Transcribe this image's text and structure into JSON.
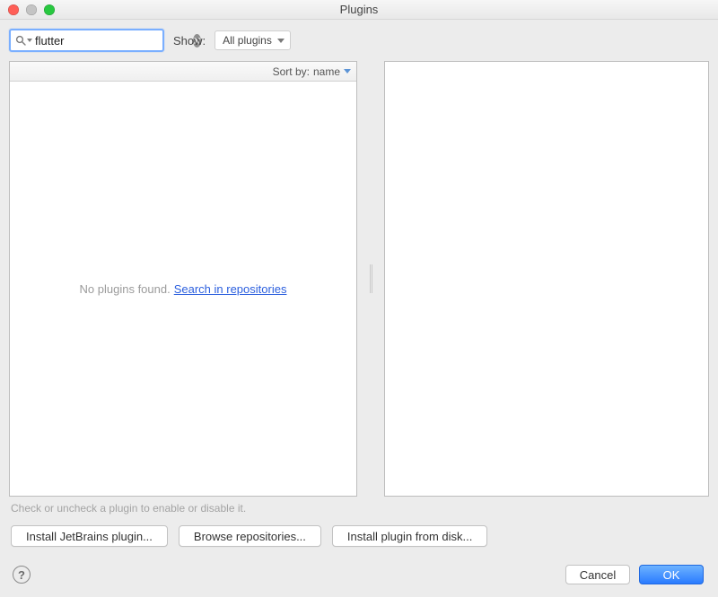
{
  "window": {
    "title": "Plugins"
  },
  "search": {
    "value": "flutter"
  },
  "show": {
    "label": "Show:",
    "selected": "All plugins"
  },
  "list": {
    "sort_label": "Sort by:",
    "sort_value": "name",
    "empty_text": "No plugins found.",
    "search_link": "Search in repositories"
  },
  "hint": "Check or uncheck a plugin to enable or disable it.",
  "buttons": {
    "install_jetbrains": "Install JetBrains plugin...",
    "browse_repositories": "Browse repositories...",
    "install_from_disk": "Install plugin from disk..."
  },
  "footer": {
    "help": "?",
    "cancel": "Cancel",
    "ok": "OK"
  }
}
